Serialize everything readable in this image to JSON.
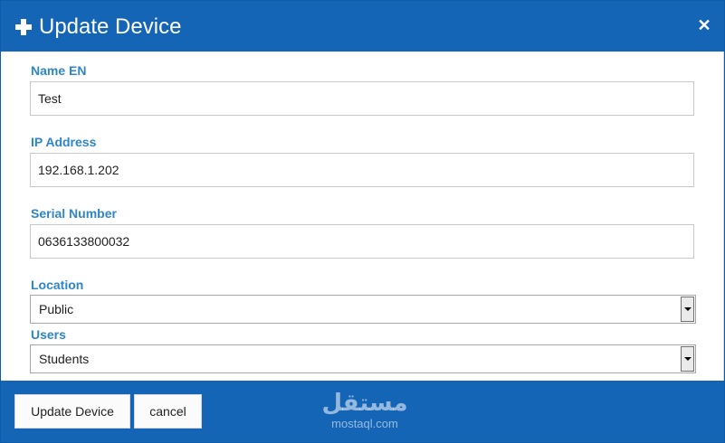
{
  "dialog": {
    "title": "Update Device",
    "plus_icon": "plus-icon",
    "close_glyph": "✕"
  },
  "form": {
    "name_en": {
      "label": "Name EN",
      "value": "Test"
    },
    "ip_address": {
      "label": "IP Address",
      "value": "192.168.1.202"
    },
    "serial_number": {
      "label": "Serial Number",
      "value": "0636133800032"
    },
    "location": {
      "label": "Location",
      "selected": "Public"
    },
    "users": {
      "label": "Users",
      "selected": "Students"
    }
  },
  "footer": {
    "update_label": "Update Device",
    "cancel_label": "cancel"
  },
  "watermark": {
    "logo": "مستقل",
    "text": "mostaql.com"
  },
  "colors": {
    "header_bg": "#1565b6",
    "label": "#2e86c9"
  }
}
